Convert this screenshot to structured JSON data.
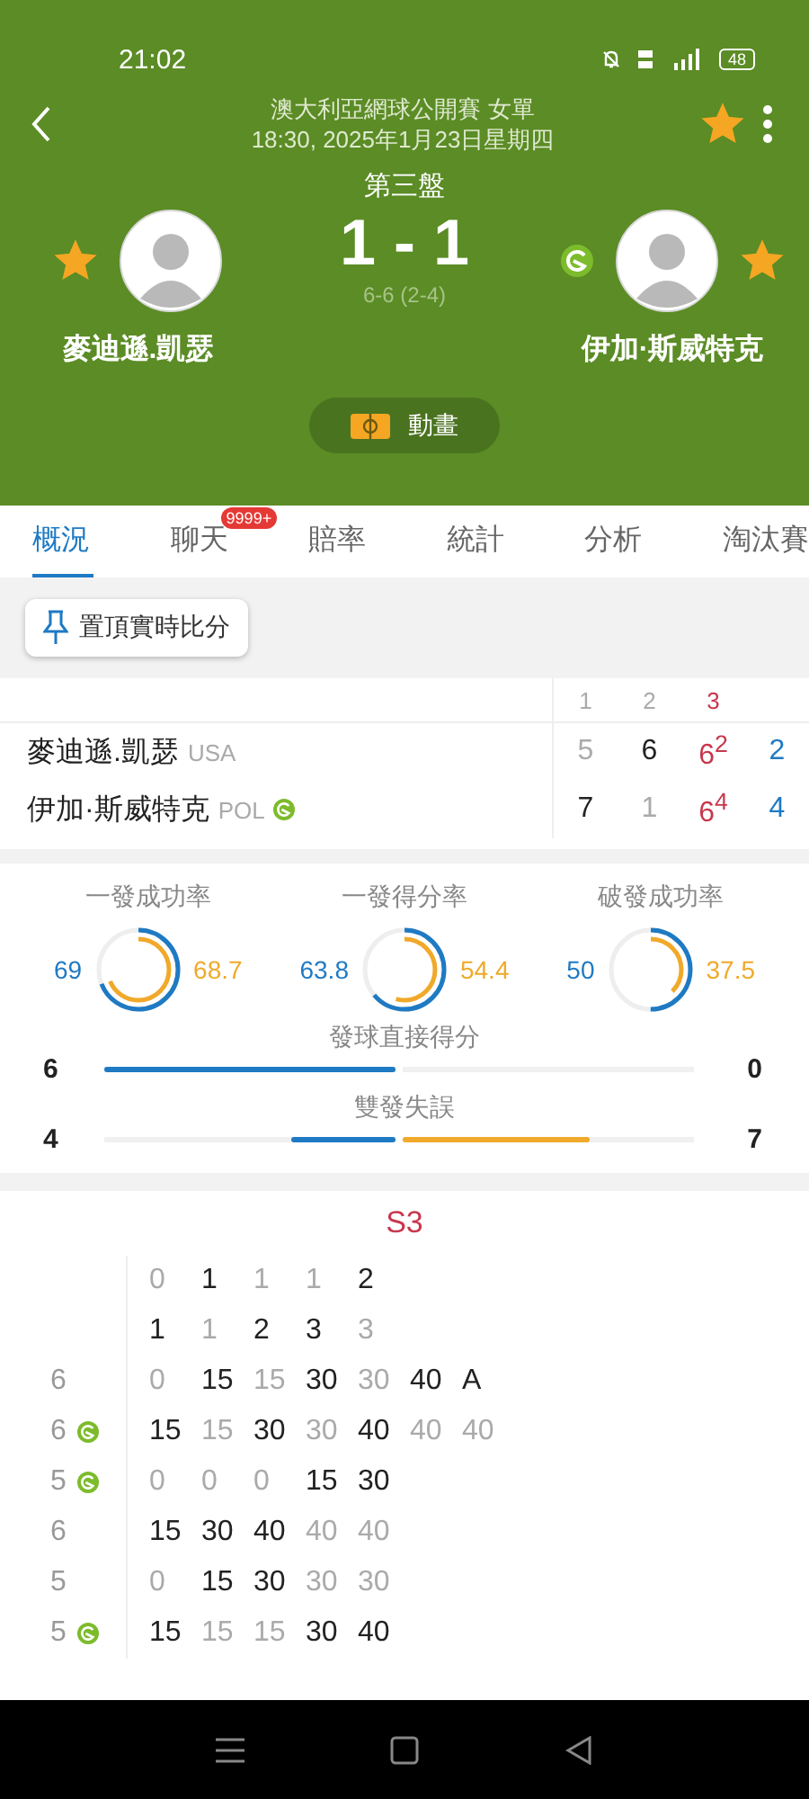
{
  "status_bar": {
    "time": "21:02",
    "battery": "48"
  },
  "header": {
    "title": "澳大利亞網球公開賽 女單",
    "subtitle": "18:30, 2025年1月23日星期四",
    "favorite": true
  },
  "match": {
    "set_label": "第三盤",
    "score": "1 - 1",
    "set_score": "6-6 (2-4)",
    "animation_button": "動畫",
    "players": [
      {
        "name": "麥迪遜.凱瑟",
        "favorite": true,
        "serving": false
      },
      {
        "name": "伊加·斯威特克",
        "favorite": true,
        "serving": true
      }
    ]
  },
  "tabs": [
    {
      "label": "概況",
      "selected": true
    },
    {
      "label": "聊天",
      "selected": false,
      "badge": "9999+"
    },
    {
      "label": "賠率",
      "selected": false
    },
    {
      "label": "統計",
      "selected": false
    },
    {
      "label": "分析",
      "selected": false
    },
    {
      "label": "淘汰賽",
      "selected": false
    }
  ],
  "pin_button": "置頂實時比分",
  "scoreboard": {
    "columns": [
      {
        "label": "1",
        "current": false
      },
      {
        "label": "2",
        "current": false
      },
      {
        "label": "3",
        "current": true
      }
    ],
    "rows": [
      {
        "name": "麥迪遜.凱瑟",
        "country": "USA",
        "serving": false,
        "sets": [
          {
            "score": "5",
            "won": false,
            "current": false
          },
          {
            "score": "6",
            "won": true,
            "current": false
          },
          {
            "score": "6$^{2}$",
            "current": true
          }
        ],
        "points": "2"
      },
      {
        "name": "伊加·斯威特克",
        "country": "POL",
        "serving": true,
        "sets": [
          {
            "score": "7",
            "won": true,
            "current": false
          },
          {
            "score": "1",
            "won": false,
            "current": false
          },
          {
            "score": "6$^{4}$",
            "current": true
          }
        ],
        "points": "4"
      }
    ]
  },
  "stats": {
    "rings": [
      {
        "label": "一發成功率",
        "home": {
          "value": "69",
          "level": 0.69
        },
        "away": {
          "value": "68.7",
          "level": 0.687
        }
      },
      {
        "label": "一發得分率",
        "home": {
          "value": "63.8",
          "level": 0.638
        },
        "away": {
          "value": "54.4",
          "level": 0.544
        }
      },
      {
        "label": "破發成功率",
        "home": {
          "value": "50",
          "level": 0.5
        },
        "away": {
          "value": "37.5",
          "level": 0.375
        }
      }
    ],
    "bars": [
      {
        "label": "發球直接得分",
        "home": {
          "value": "6",
          "level": 1
        },
        "away": {
          "value": "0",
          "level": 0
        }
      },
      {
        "label": "雙發失誤",
        "home": {
          "value": "4",
          "level": 0.36
        },
        "away": {
          "value": "7",
          "level": 0.64
        }
      }
    ]
  },
  "point_by_point": {
    "title": "S3",
    "games": [
      {
        "rows": [
          {
            "serving": false,
            "points": [
              {
                "text": "0",
                "highlighted": false
              },
              {
                "text": "1",
                "highlighted": true
              },
              {
                "text": "1",
                "highlighted": false
              },
              {
                "text": "1",
                "highlighted": false
              },
              {
                "text": "2",
                "highlighted": true
              }
            ]
          },
          {
            "serving": false,
            "points": [
              {
                "text": "1",
                "highlighted": true
              },
              {
                "text": "1",
                "highlighted": false
              },
              {
                "text": "2",
                "highlighted": true
              },
              {
                "text": "3",
                "highlighted": true
              },
              {
                "text": "3",
                "highlighted": false
              }
            ]
          }
        ]
      },
      {
        "rows": [
          {
            "games": "6",
            "serving": false,
            "points": [
              {
                "text": "0",
                "highlighted": false
              },
              {
                "text": "15",
                "highlighted": true
              },
              {
                "text": "15",
                "highlighted": false
              },
              {
                "text": "30",
                "highlighted": true
              },
              {
                "text": "30",
                "highlighted": false
              },
              {
                "text": "40",
                "highlighted": true
              },
              {
                "text": "A",
                "highlighted": true
              }
            ]
          },
          {
            "games": "6",
            "serving": true,
            "points": [
              {
                "text": "15",
                "highlighted": true
              },
              {
                "text": "15",
                "highlighted": false
              },
              {
                "text": "30",
                "highlighted": true
              },
              {
                "text": "30",
                "highlighted": false
              },
              {
                "text": "40",
                "highlighted": true
              },
              {
                "text": "40",
                "highlighted": false
              },
              {
                "text": "40",
                "highlighted": false
              }
            ]
          }
        ]
      },
      {
        "rows": [
          {
            "games": "5",
            "serving": true,
            "points": [
              {
                "text": "0",
                "highlighted": false
              },
              {
                "text": "0",
                "highlighted": false
              },
              {
                "text": "0",
                "highlighted": false
              },
              {
                "text": "15",
                "highlighted": true
              },
              {
                "text": "30",
                "highlighted": true
              }
            ]
          },
          {
            "games": "6",
            "serving": false,
            "points": [
              {
                "text": "15",
                "highlighted": true
              },
              {
                "text": "30",
                "highlighted": true
              },
              {
                "text": "40",
                "highlighted": true
              },
              {
                "text": "40",
                "highlighted": false
              },
              {
                "text": "40",
                "highlighted": false
              }
            ]
          }
        ]
      },
      {
        "rows": [
          {
            "games": "5",
            "serving": false,
            "points": [
              {
                "text": "0",
                "highlighted": false
              },
              {
                "text": "15",
                "highlighted": true
              },
              {
                "text": "30",
                "highlighted": true
              },
              {
                "text": "30",
                "highlighted": false
              },
              {
                "text": "30",
                "highlighted": false
              }
            ]
          },
          {
            "games": "5",
            "serving": true,
            "points": [
              {
                "text": "15",
                "highlighted": true
              },
              {
                "text": "15",
                "highlighted": false
              },
              {
                "text": "15",
                "highlighted": false
              },
              {
                "text": "30",
                "highlighted": true
              },
              {
                "text": "40",
                "highlighted": true
              }
            ]
          }
        ]
      }
    ]
  }
}
